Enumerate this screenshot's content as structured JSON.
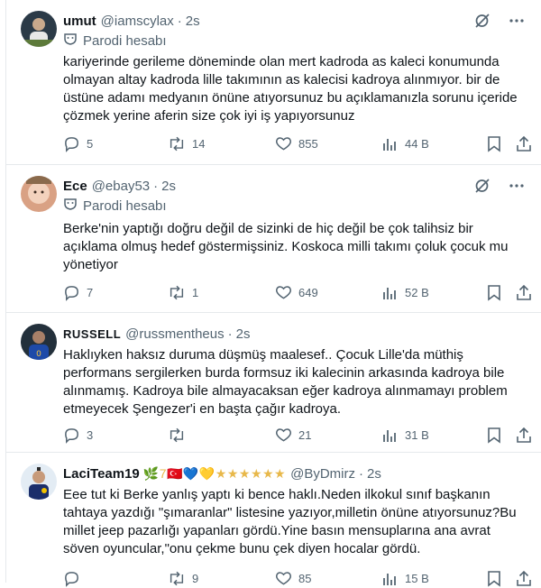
{
  "tweets": [
    {
      "name": "umut",
      "handle": "@iamscylax",
      "dot": "·",
      "time": "2s",
      "badge_text": "",
      "parody_label": "Parodi hesabı",
      "text": "kariyerinde gerileme döneminde olan mert kadroda as kaleci konumunda olmayan altay kadroda lille takımının as kalecisi kadroya alınmıyor. bir de üstüne adamı medyanın önüne atıyorsunuz bu açıklamanızla sorunu içeride çözmek yerine aferin size çok iyi iş yapıyorsunuz",
      "replies": "5",
      "reposts": "14",
      "likes": "855",
      "views": "44 B",
      "avatar_color": "#2b3a47"
    },
    {
      "name": "Ece",
      "handle": "@ebay53",
      "dot": "·",
      "time": "2s",
      "badge_text": "",
      "parody_label": "Parodi hesabı",
      "text": "Berke'nin yaptığı doğru değil de sizinki de hiç değil be çok talihsiz bir açıklama olmuş hedef göstermişsiniz. Koskoca milli takımı çoluk çocuk mu yönetiyor",
      "replies": "7",
      "reposts": "1",
      "likes": "649",
      "views": "52 B",
      "avatar_color": "#d9a184"
    },
    {
      "name": "RUSSELL",
      "handle": "@russmentheus",
      "dot": "·",
      "time": "2s",
      "badge_text": "",
      "parody_label": "",
      "text": "Haklıyken haksız duruma düşmüş maalesef.. Çocuk Lille'da müthiş performans sergilerken burda formsuz iki kalecinin arkasında kadroya bile alınmamış. Kadroya bile almayacaksan eğer kadroya alınmamayı problem etmeyecek Şengezer'i en başta çağır kadroya.",
      "replies": "3",
      "reposts": "",
      "likes": "21",
      "views": "31 B",
      "avatar_color": "#23303b"
    },
    {
      "name": "LaciTeam19",
      "handle": "@ByDmirz",
      "dot": "·",
      "time": "2s",
      "badge_text": "🌿7🇹🇷💙💛★★★★★★",
      "parody_label": "",
      "text": "Eee tut ki Berke yanlış yaptı ki bence haklı.Neden ilkokul sınıf başkanın tahtaya yazdığı \"şımaranlar\" listesine yazıyor,milletin önüne atıyorsunuz?Bu millet jeep pazarlığı yapanları gördü.Yine basın mensuplarına ana avrat söven oyuncular,\"onu çekme bunu çek diyen hocalar gördü.",
      "replies": "",
      "reposts": "9",
      "likes": "85",
      "views": "15 B",
      "avatar_color": "#e3ecf4"
    }
  ]
}
